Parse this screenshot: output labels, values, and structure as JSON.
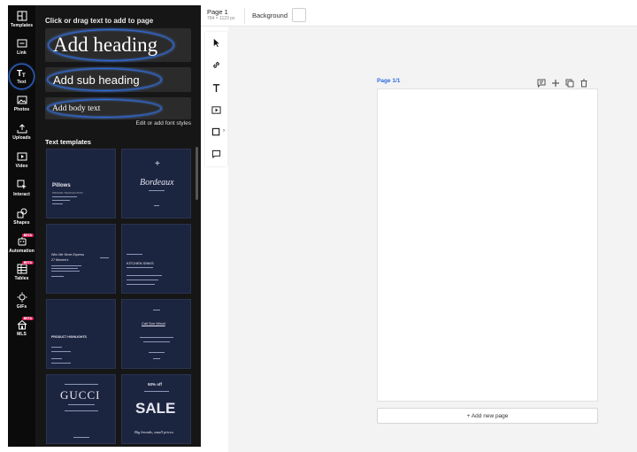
{
  "rail": {
    "items": [
      {
        "label": "Templates",
        "icon": "templates-icon"
      },
      {
        "label": "Link",
        "icon": "link-box-icon"
      },
      {
        "label": "Text",
        "icon": "text-icon"
      },
      {
        "label": "Photos",
        "icon": "photo-icon"
      },
      {
        "label": "Uploads",
        "icon": "upload-icon"
      },
      {
        "label": "Video",
        "icon": "video-icon"
      },
      {
        "label": "Interact",
        "icon": "interact-icon"
      },
      {
        "label": "Shapes",
        "icon": "shapes-icon"
      },
      {
        "label": "Automation",
        "icon": "automation-icon"
      },
      {
        "label": "Tables",
        "icon": "table-icon"
      },
      {
        "label": "GIFs",
        "icon": "gif-icon"
      },
      {
        "label": "MLS",
        "icon": "house-icon"
      }
    ],
    "beta_label": "BETA"
  },
  "panel": {
    "hint": "Click or drag text to add to page",
    "heading_label": "Add heading",
    "subheading_label": "Add sub heading",
    "body_label": "Add body text",
    "edit_fonts": "Edit or add font styles",
    "templates_title": "Text templates",
    "templates": {
      "t1": {
        "title": "Pillows",
        "sub": "PRIVATE TRANSACTION"
      },
      "t2": {
        "title": "Bordeaux",
        "plus": "+"
      },
      "t3": {
        "title": "Who We Serve Express",
        "sub": "27 Women's"
      },
      "t4": {
        "title": "KITCHEN SINKS"
      },
      "t5": {
        "title": "PRODUCT HIGHLIGHTS"
      },
      "t6": {
        "title": "Call Sun Wood"
      },
      "t7": {
        "title": "GUCCI"
      },
      "t8": {
        "title": "SALE",
        "top": "50% off",
        "bottom": "Big brands, small prices"
      }
    }
  },
  "topbar": {
    "page_title": "Page 1",
    "page_size": "794 × 1123 px",
    "background_label": "Background"
  },
  "canvas": {
    "page_number": "Page 1/1",
    "add_page_label": "+ Add new page"
  },
  "colors": {
    "accent": "#2d6cdf",
    "rail_bg": "#0b0b0b",
    "panel_bg": "#161616",
    "template_bg": "#1c2540",
    "canvas_bg": "#f3f3f3",
    "beta": "#e0245e"
  }
}
